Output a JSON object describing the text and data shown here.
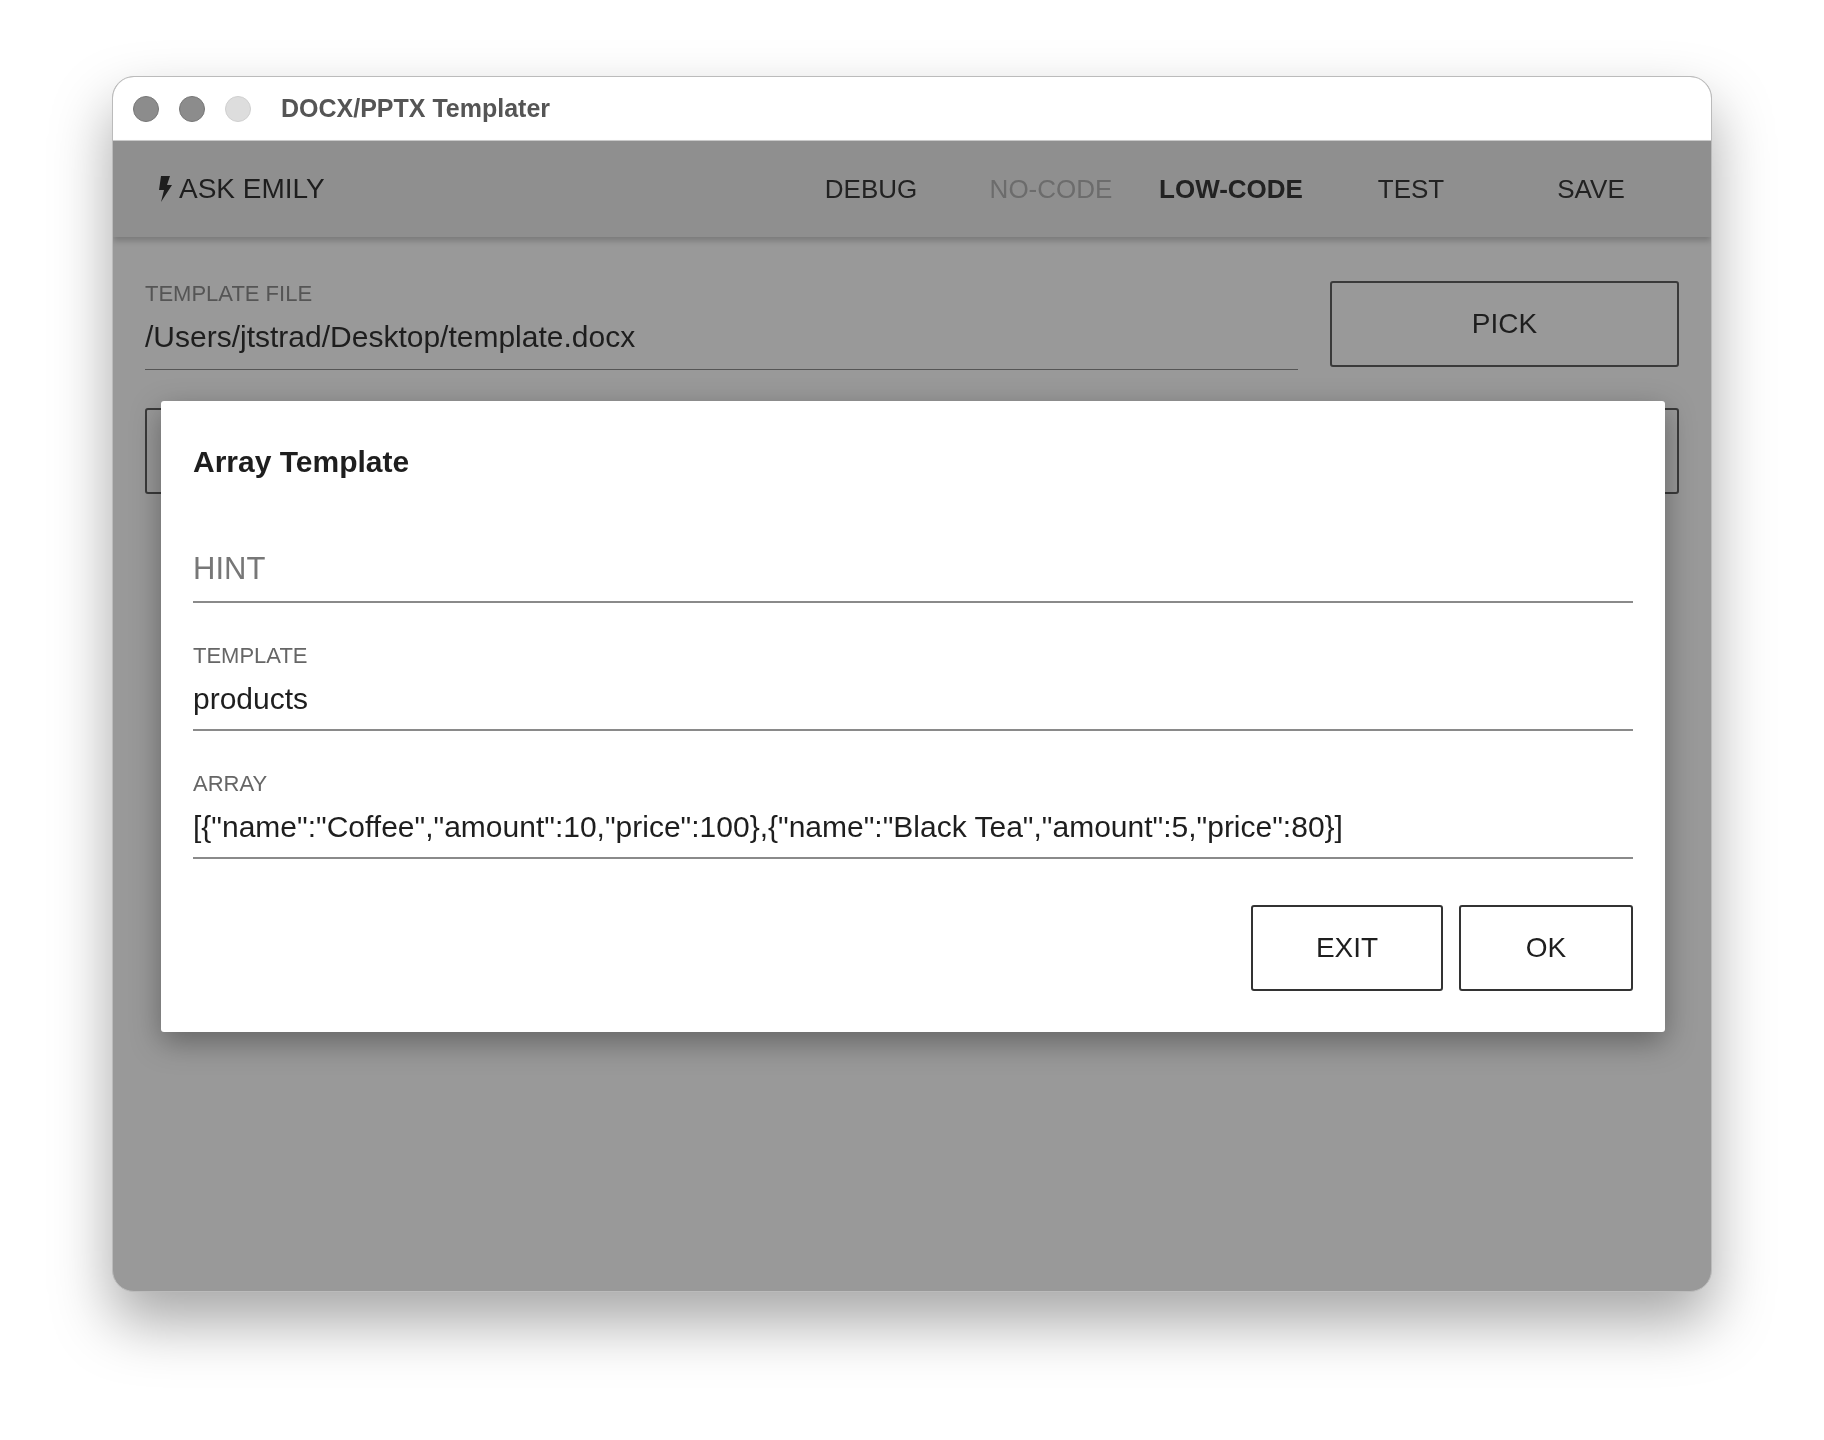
{
  "window": {
    "title": "DOCX/PPTX Templater"
  },
  "toolbar": {
    "ask": "ASK EMILY",
    "items": [
      {
        "label": "DEBUG",
        "selected": false,
        "disabled": false
      },
      {
        "label": "NO-CODE",
        "selected": false,
        "disabled": true
      },
      {
        "label": "LOW-CODE",
        "selected": true,
        "disabled": false
      },
      {
        "label": "TEST",
        "selected": false,
        "disabled": false
      },
      {
        "label": "SAVE",
        "selected": false,
        "disabled": false
      }
    ]
  },
  "template_file": {
    "label": "TEMPLATE FILE",
    "value": "/Users/jtstrad/Desktop/template.docx",
    "button": "PICK"
  },
  "dialog": {
    "title": "Array Template",
    "fields": [
      {
        "placeholder": "HINT"
      },
      {
        "label": "TEMPLATE",
        "value": "products"
      },
      {
        "label": "ARRAY",
        "value": "[{\"name\":\"Coffee\",\"amount\":10,\"price\":100},{\"name\":\"Black Tea\",\"amount\":5,\"price\":80}]"
      }
    ],
    "buttons": [
      "EXIT",
      "OK"
    ]
  }
}
